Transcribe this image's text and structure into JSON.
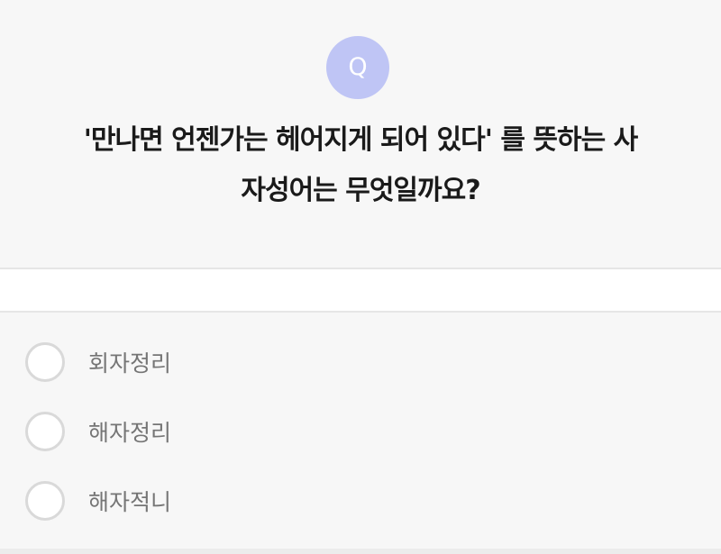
{
  "quiz": {
    "badge": "Q",
    "question_line1": "'만나면 언젠가는 헤어지게 되어 있다' 를 뜻하는 사",
    "question_line2": "자성어는 무엇일까요?",
    "options": [
      {
        "label": "회자정리",
        "selected": false
      },
      {
        "label": "해자정리",
        "selected": false
      },
      {
        "label": "해자적니",
        "selected": false
      }
    ]
  },
  "colors": {
    "badge": "#bfc5f5",
    "background": "#f7f7f7",
    "question_text": "#1a1a1a",
    "option_text": "#757575",
    "radio_border": "#d9d9d9"
  }
}
